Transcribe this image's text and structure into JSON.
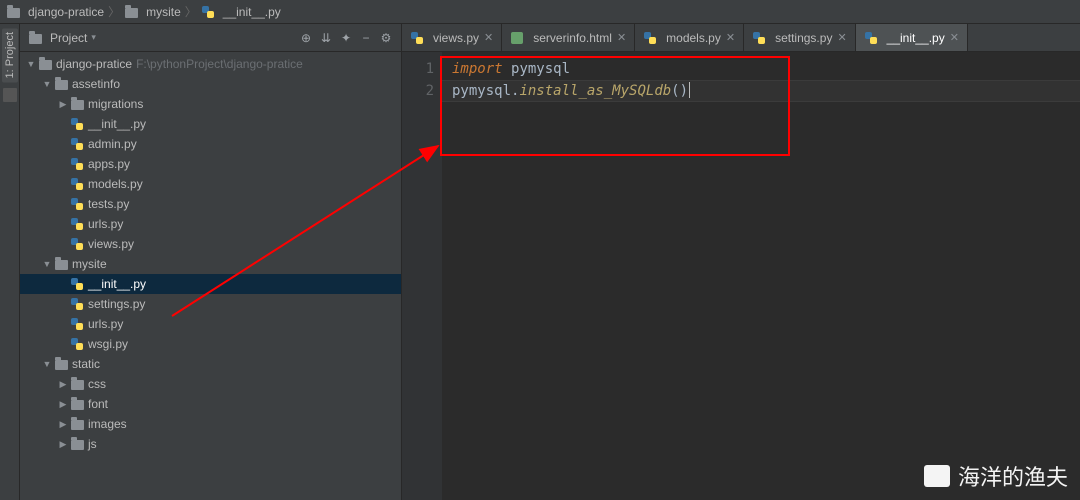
{
  "breadcrumb": {
    "root": "django-pratice",
    "folder": "mysite",
    "file": "__init__.py"
  },
  "sidebar": {
    "title": "Project",
    "project_path": "F:\\pythonProject\\django-pratice",
    "items": [
      {
        "label": "django-pratice",
        "depth": 0,
        "kind": "folder",
        "expanded": true,
        "has_children": true,
        "path_hint": "F:\\pythonProject\\django-pratice"
      },
      {
        "label": "assetinfo",
        "depth": 1,
        "kind": "folder",
        "expanded": true,
        "has_children": true
      },
      {
        "label": "migrations",
        "depth": 2,
        "kind": "folder",
        "expanded": false,
        "has_children": true
      },
      {
        "label": "__init__.py",
        "depth": 2,
        "kind": "py"
      },
      {
        "label": "admin.py",
        "depth": 2,
        "kind": "py"
      },
      {
        "label": "apps.py",
        "depth": 2,
        "kind": "py"
      },
      {
        "label": "models.py",
        "depth": 2,
        "kind": "py"
      },
      {
        "label": "tests.py",
        "depth": 2,
        "kind": "py"
      },
      {
        "label": "urls.py",
        "depth": 2,
        "kind": "py"
      },
      {
        "label": "views.py",
        "depth": 2,
        "kind": "py"
      },
      {
        "label": "mysite",
        "depth": 1,
        "kind": "folder",
        "expanded": true,
        "has_children": true
      },
      {
        "label": "__init__.py",
        "depth": 2,
        "kind": "py",
        "selected": true
      },
      {
        "label": "settings.py",
        "depth": 2,
        "kind": "py"
      },
      {
        "label": "urls.py",
        "depth": 2,
        "kind": "py"
      },
      {
        "label": "wsgi.py",
        "depth": 2,
        "kind": "py"
      },
      {
        "label": "static",
        "depth": 1,
        "kind": "folder",
        "expanded": true,
        "has_children": true
      },
      {
        "label": "css",
        "depth": 2,
        "kind": "folder",
        "expanded": false,
        "has_children": true
      },
      {
        "label": "font",
        "depth": 2,
        "kind": "folder",
        "expanded": false,
        "has_children": true
      },
      {
        "label": "images",
        "depth": 2,
        "kind": "folder",
        "expanded": false,
        "has_children": true
      },
      {
        "label": "js",
        "depth": 2,
        "kind": "folder",
        "expanded": false,
        "has_children": true
      }
    ]
  },
  "tabs": [
    {
      "label": "views.py",
      "kind": "py"
    },
    {
      "label": "serverinfo.html",
      "kind": "html"
    },
    {
      "label": "models.py",
      "kind": "py"
    },
    {
      "label": "settings.py",
      "kind": "py"
    },
    {
      "label": "__init__.py",
      "kind": "py",
      "active": true
    }
  ],
  "editor": {
    "lines": [
      "1",
      "2"
    ],
    "code": {
      "l1_kw": "import",
      "l1_mod": "pymysql",
      "l2_obj": "pymysql",
      "l2_fn": "install_as_MySQLdb",
      "l2_tail": "()"
    }
  },
  "rail": {
    "project_tab": "1: Project"
  },
  "watermark": "海洋的渔夫"
}
